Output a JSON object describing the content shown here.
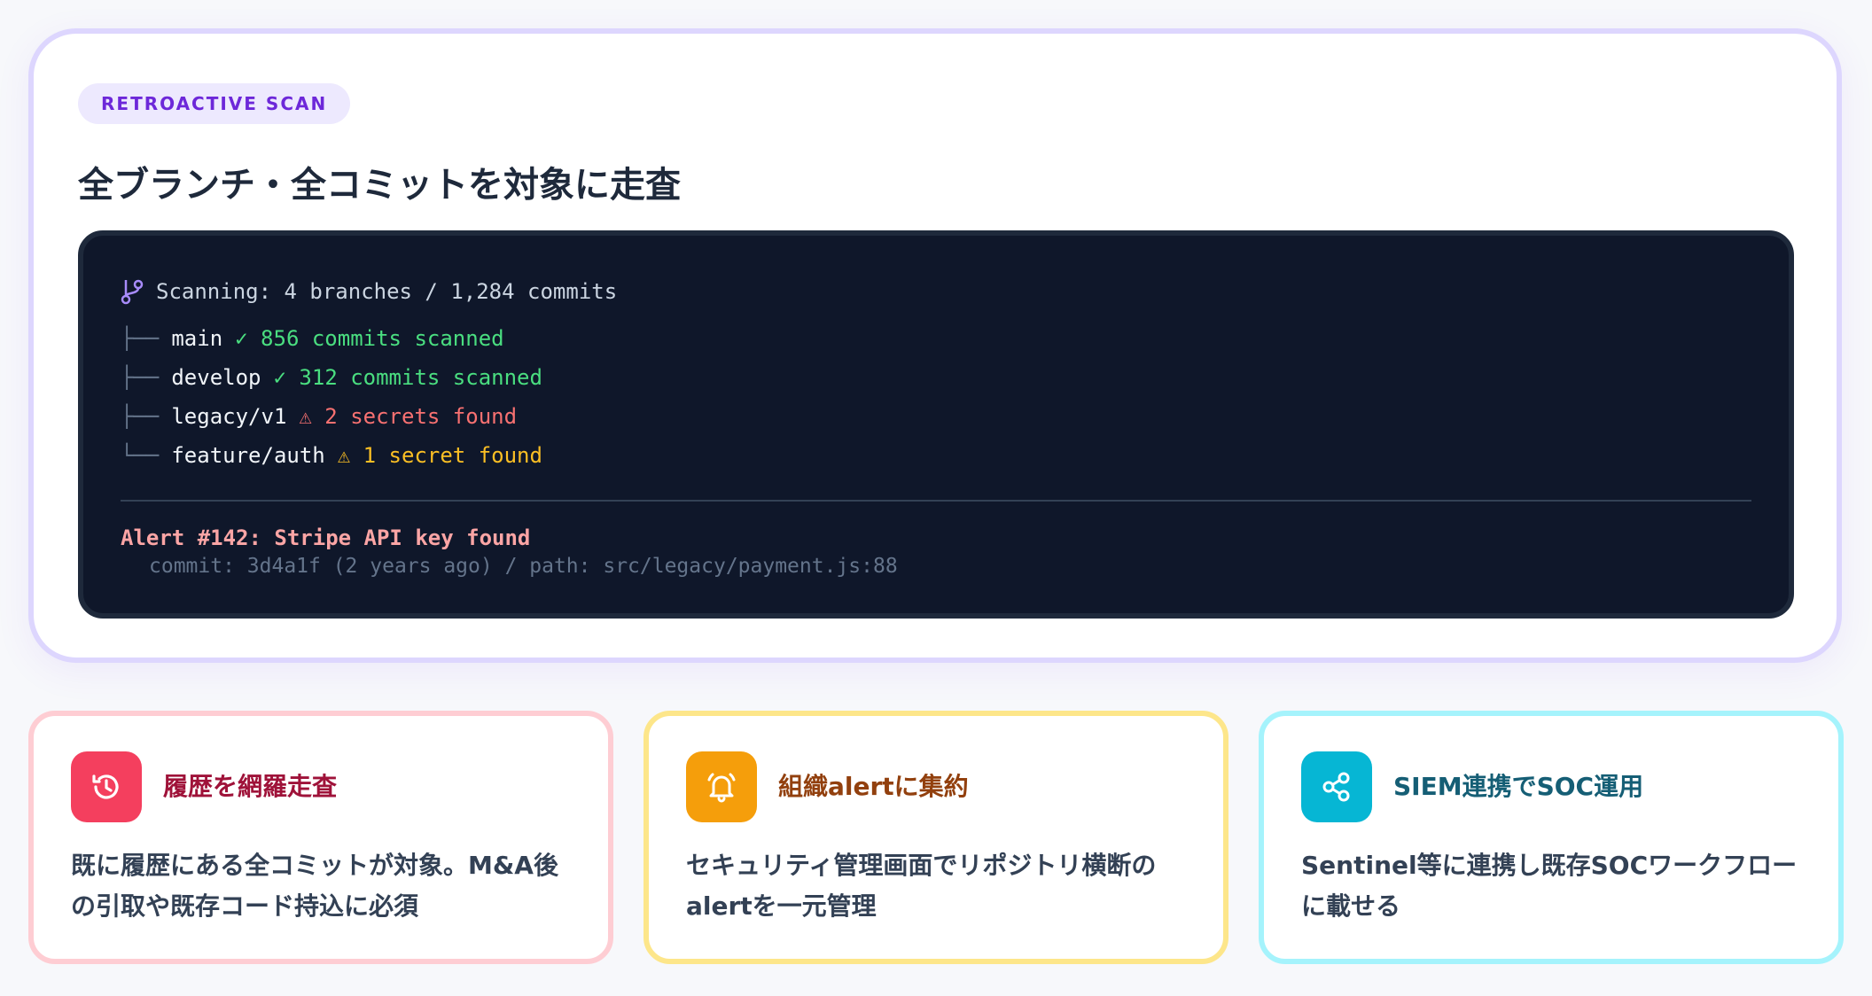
{
  "hero": {
    "badge": "RETROACTIVE SCAN",
    "title": "全ブランチ・全コミットを対象に走査"
  },
  "terminal": {
    "scanning": "Scanning: 4 branches / 1,284 commits",
    "branches": [
      {
        "prefix": "├──",
        "name": "main",
        "status": "✓ 856 commits scanned",
        "kind": "ok"
      },
      {
        "prefix": "├──",
        "name": "develop",
        "status": "✓ 312 commits scanned",
        "kind": "ok"
      },
      {
        "prefix": "├──",
        "name": "legacy/v1",
        "status": "⚠ 2 secrets found",
        "kind": "danger"
      },
      {
        "prefix": "└──",
        "name": "feature/auth",
        "status": "⚠ 1 secret found",
        "kind": "warn"
      }
    ],
    "alert_title": "Alert #142: Stripe API key found",
    "alert_meta": "commit: 3d4a1f (2 years ago) / path: src/legacy/payment.js:88"
  },
  "cards": [
    {
      "title": "履歴を網羅走査",
      "desc": "既に履歴にある全コミットが対象。M&A後の引取や既存コード持込に必須",
      "icon": "history-icon"
    },
    {
      "title": "組織alertに集約",
      "desc": "セキュリティ管理画面でリポジトリ横断のalertを一元管理",
      "icon": "bell-icon"
    },
    {
      "title": "SIEM連携でSOC運用",
      "desc": "Sentinel等に連携し既存SOCワークフローに載せる",
      "icon": "share-icon"
    }
  ],
  "colors": {
    "accent": "#7c3aed",
    "ok": "#4ade80",
    "danger": "#f87171",
    "warn": "#fbbf24"
  }
}
